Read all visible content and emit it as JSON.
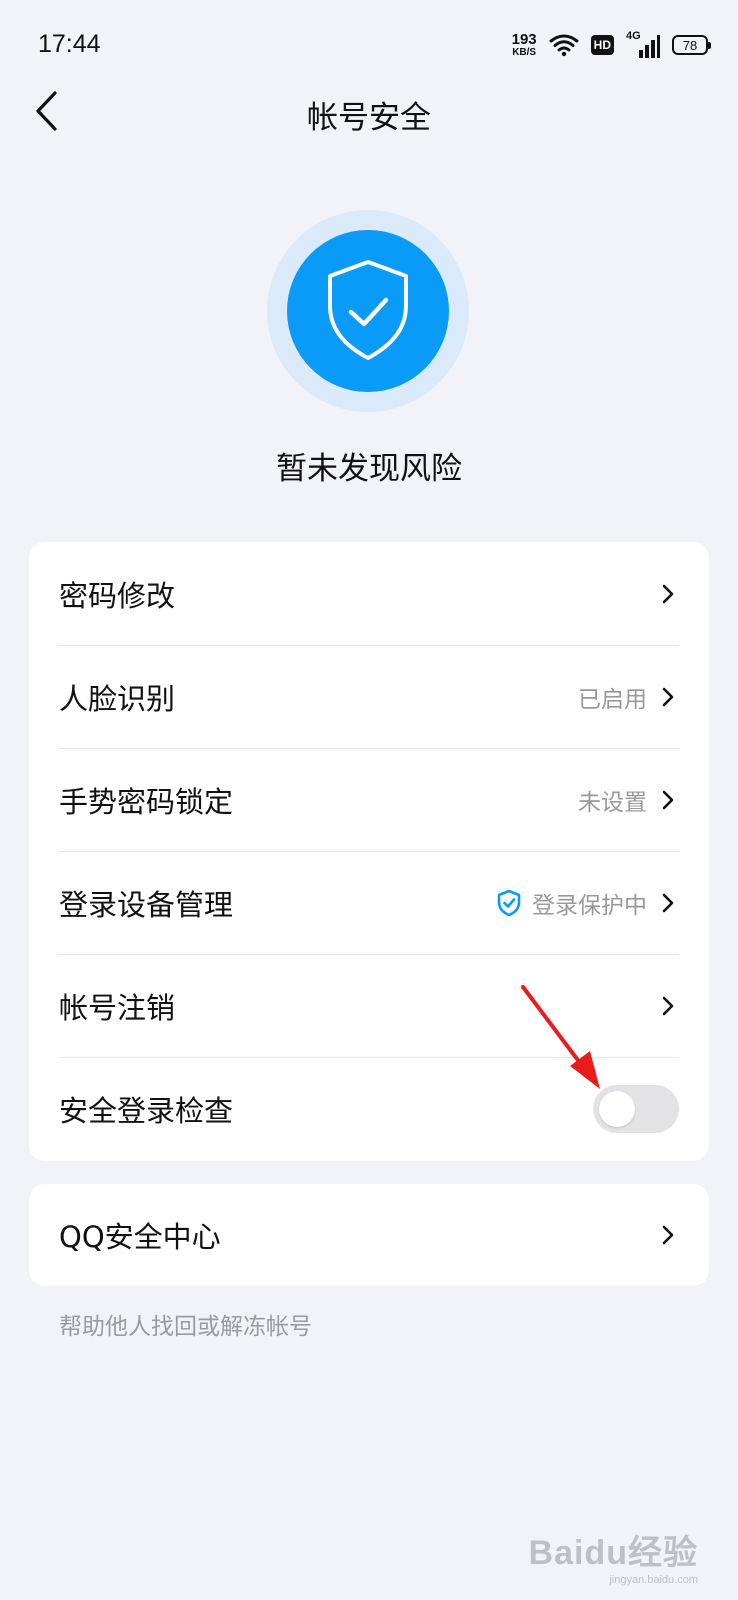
{
  "status_bar": {
    "time": "17:44",
    "net_speed": "193",
    "net_unit": "KB/S",
    "hd": "HD",
    "network_type": "4G",
    "battery": "78"
  },
  "header": {
    "title": "帐号安全"
  },
  "security": {
    "status_text": "暂未发现风险",
    "accent_color": "#0a9af8"
  },
  "settings": {
    "items": [
      {
        "label": "密码修改",
        "status": ""
      },
      {
        "label": "人脸识别",
        "status": "已启用"
      },
      {
        "label": "手势密码锁定",
        "status": "未设置"
      },
      {
        "label": "登录设备管理",
        "status": "登录保护中"
      },
      {
        "label": "帐号注销",
        "status": ""
      },
      {
        "label": "安全登录检查",
        "toggle": false
      }
    ]
  },
  "qq_center": {
    "label": "QQ安全中心",
    "helper": "帮助他人找回或解冻帐号"
  },
  "watermark": {
    "brand": "Baidu经验",
    "url": "jingyan.baidu.com"
  }
}
